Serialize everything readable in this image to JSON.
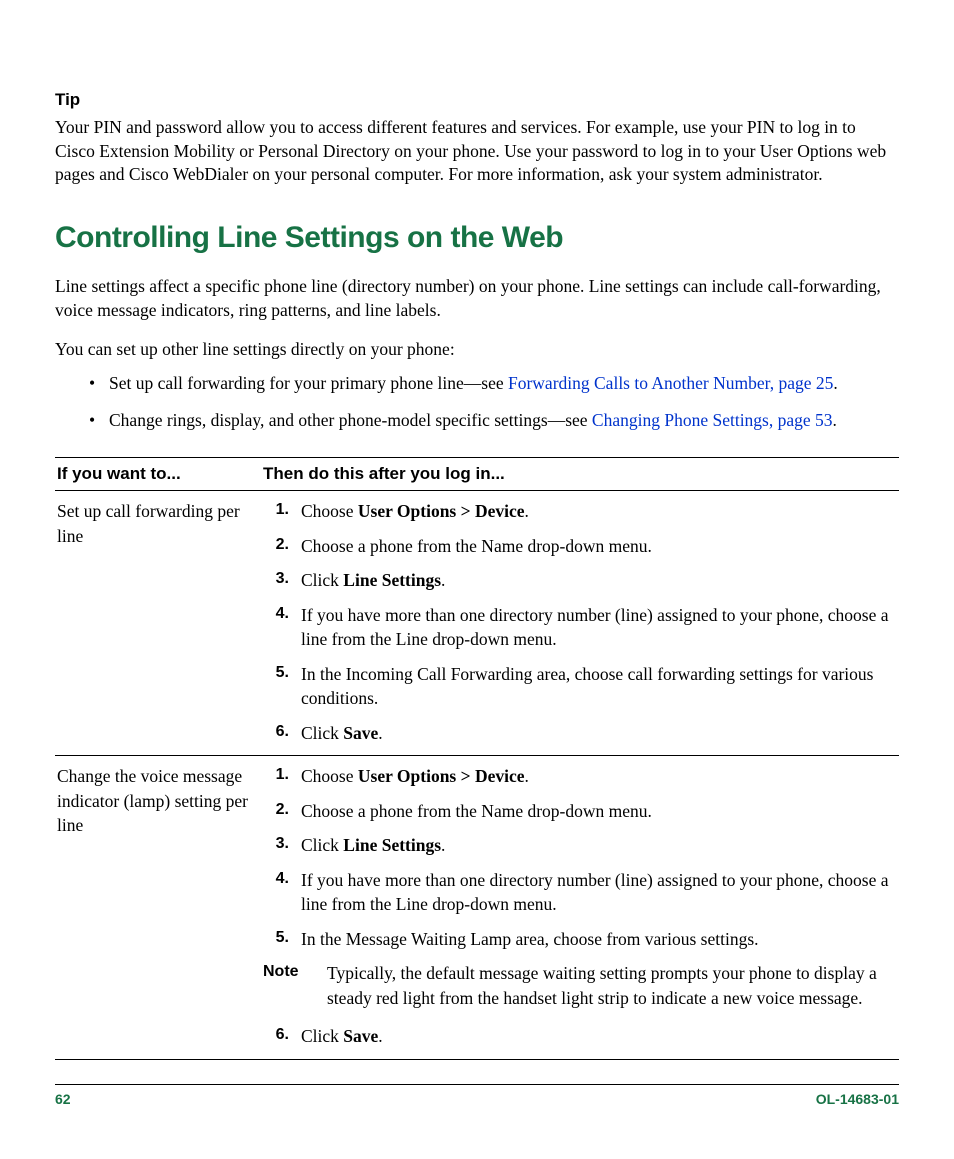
{
  "tip": {
    "heading": "Tip",
    "body": "Your PIN and password allow you to access different features and services. For example, use your PIN to log in to Cisco Extension Mobility or Personal Directory on your phone. Use your password to log in to your User Options web pages and Cisco WebDialer on your personal computer. For more information, ask your system administrator."
  },
  "section_title": "Controlling Line Settings on the Web",
  "intro_p1": "Line settings affect a specific phone line (directory number) on your phone. Line settings can include call-forwarding, voice message indicators, ring patterns, and line labels.",
  "intro_p2": "You can set up other line settings directly on your phone:",
  "bullets": [
    {
      "pre": "Set up call forwarding for your primary phone line—see ",
      "link": "Forwarding Calls to Another Number, page 25",
      "post": "."
    },
    {
      "pre": "Change rings, display, and other phone-model specific settings—see ",
      "link": "Changing Phone Settings, page 53",
      "post": "."
    }
  ],
  "table": {
    "headers": {
      "col1": "If you want to...",
      "col2": "Then do this after you log in..."
    },
    "rows": [
      {
        "want": "Set up call forwarding per line",
        "steps": [
          {
            "n": "1.",
            "before": "Choose ",
            "bold": "User Options > Device",
            "after": "."
          },
          {
            "n": "2.",
            "before": "Choose a phone from the Name drop-down menu.",
            "bold": "",
            "after": ""
          },
          {
            "n": "3.",
            "before": "Click ",
            "bold": "Line Settings",
            "after": "."
          },
          {
            "n": "4.",
            "before": "If you have more than one directory number (line) assigned to your phone, choose a line from the Line drop-down menu.",
            "bold": "",
            "after": ""
          },
          {
            "n": "5.",
            "before": "In the Incoming Call Forwarding area, choose call forwarding settings for various conditions.",
            "bold": "",
            "after": ""
          },
          {
            "n": "6.",
            "before": "Click ",
            "bold": "Save",
            "after": "."
          }
        ]
      },
      {
        "want": "Change the voice message indicator (lamp) setting per line",
        "steps": [
          {
            "n": "1.",
            "before": "Choose ",
            "bold": "User Options > Device",
            "after": "."
          },
          {
            "n": "2.",
            "before": "Choose a phone from the Name drop-down menu.",
            "bold": "",
            "after": ""
          },
          {
            "n": "3.",
            "before": "Click ",
            "bold": "Line Settings",
            "after": "."
          },
          {
            "n": "4.",
            "before": "If you have more than one directory number (line) assigned to your phone, choose a line from the Line drop-down menu.",
            "bold": "",
            "after": ""
          },
          {
            "n": "5.",
            "before": "In the Message Waiting Lamp area, choose from various settings.",
            "bold": "",
            "after": ""
          }
        ],
        "note": {
          "label": "Note",
          "text": "Typically, the default message waiting setting prompts your phone to display a steady red light from the handset light strip to indicate a new voice message."
        },
        "steps_after_note": [
          {
            "n": "6.",
            "before": "Click ",
            "bold": "Save",
            "after": "."
          }
        ]
      }
    ]
  },
  "footer": {
    "page": "62",
    "docid": "OL-14683-01"
  }
}
